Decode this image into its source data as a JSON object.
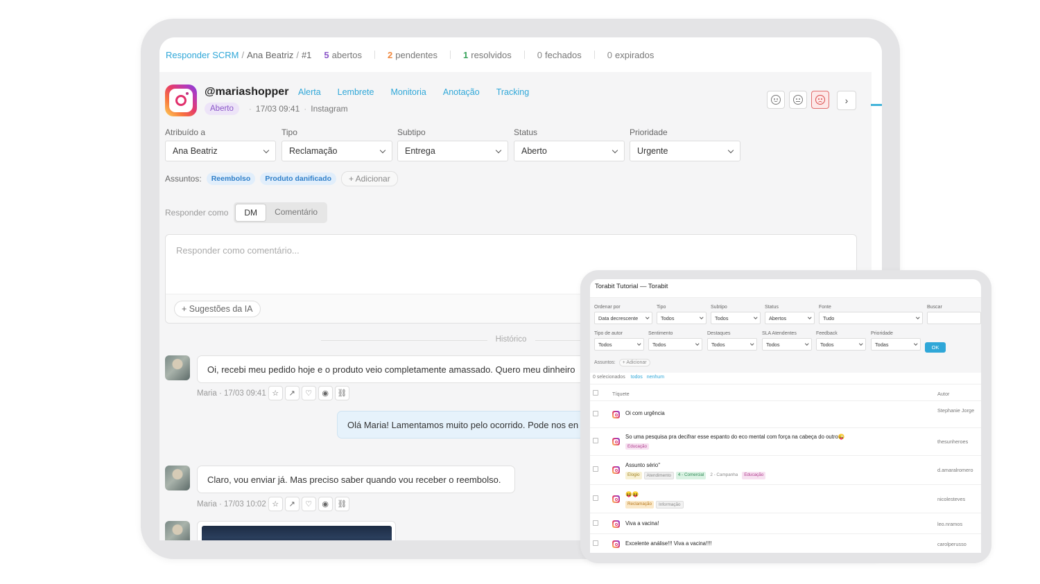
{
  "colors": {
    "accent": "#2fa7d8",
    "open": "#8a56c8",
    "pending": "#f0883e",
    "resolved": "#3aa35c",
    "negative": "#d94a4a"
  },
  "topbar": {
    "app": "Responder SCRM",
    "sep1": "/",
    "agent": "Ana Beatriz",
    "sep2": "/",
    "ticket": "#1",
    "stats": [
      {
        "num": "5",
        "label": "abertos",
        "color": "#8a56c8"
      },
      {
        "num": "2",
        "label": "pendentes",
        "color": "#f0883e"
      },
      {
        "num": "1",
        "label": "resolvidos",
        "color": "#3aa35c"
      },
      {
        "num": "0",
        "label": "fechados",
        "color": "#888888"
      },
      {
        "num": "0",
        "label": "expirados",
        "color": "#888888"
      }
    ]
  },
  "ticket": {
    "platform_icon": "instagram-icon",
    "handle": "@mariashopper",
    "actions": [
      "Alerta",
      "Lembrete",
      "Monitoria",
      "Anotação",
      "Tracking"
    ],
    "status_badge": "Aberto",
    "sep": "·",
    "datetime": "17/03 09:41",
    "source": "Instagram",
    "sentiment": [
      "positive",
      "neutral",
      "negative"
    ],
    "sentiment_selected": "negative",
    "next_icon": "›"
  },
  "fields": [
    {
      "label": "Atribuído a",
      "value": "Ana Beatriz"
    },
    {
      "label": "Tipo",
      "value": "Reclamação"
    },
    {
      "label": "Subtipo",
      "value": "Entrega"
    },
    {
      "label": "Status",
      "value": "Aberto"
    },
    {
      "label": "Prioridade",
      "value": "Urgente"
    }
  ],
  "subjects": {
    "label": "Assuntos:",
    "tags": [
      "Reembolso",
      "Produto danificado"
    ],
    "add": "+ Adicionar"
  },
  "reply": {
    "label": "Responder como",
    "options": [
      "DM",
      "Comentário"
    ],
    "selected": "DM",
    "placeholder": "Responder como comentário...",
    "ai_button": "+ Sugestões da IA"
  },
  "history_label": "Histórico",
  "messages": [
    {
      "text": "Oi, recebi meu pedido hoje e o produto veio completamente amassado. Quero meu dinheiro",
      "meta": "Maria · 17/03 09:41",
      "direction": "in"
    },
    {
      "text": "Olá Maria! Lamentamos muito pelo ocorrido. Pode nos en",
      "direction": "out"
    },
    {
      "text": "Claro, vou enviar já. Mas preciso saber quando vou receber o reembolso.",
      "meta": "Maria · 17/03 10:02",
      "direction": "in"
    }
  ],
  "message_tools": [
    "☆",
    "↗",
    "♡",
    "◉",
    "⛓"
  ],
  "small": {
    "title": "Torabit Tutorial — Torabit",
    "filters": [
      {
        "label": "Ordenar por",
        "value": "Data decrescente"
      },
      {
        "label": "Tipo",
        "value": "Todos"
      },
      {
        "label": "Subtipo",
        "value": "Todos"
      },
      {
        "label": "Status",
        "value": "Abertos"
      },
      {
        "label": "Fonte",
        "value": "Tudo"
      },
      {
        "label": "Buscar",
        "value": ""
      },
      {
        "label": "Tipo de autor",
        "value": "Todos"
      },
      {
        "label": "Sentimento",
        "value": "Todos"
      },
      {
        "label": "Destaques",
        "value": "Todos"
      },
      {
        "label": "SLA Atendentes",
        "value": "Todos"
      },
      {
        "label": "Feedback",
        "value": "Todos"
      },
      {
        "label": "Prioridade",
        "value": "Todas"
      }
    ],
    "ok": "OK",
    "subjects_label": "Assuntos:",
    "subjects_add": "+ Adicionar",
    "selected_count": "0 selecionados",
    "select_all": "todos",
    "select_none": "nenhum",
    "col_ticket": "Tíquete",
    "col_author": "Autor",
    "rows": [
      {
        "subject": "Oi com urgência",
        "tags": [],
        "author": "Stephanie Jorge"
      },
      {
        "subject": "So uma pesquisa pra decifrar esse espanto do eco mental com força na cabeça do outro😜",
        "tags": [
          "Educação"
        ],
        "author": "thesunheroes"
      },
      {
        "subject": "Assunto sério\"",
        "tags": [
          "Elogio",
          "Atendimento",
          "4 - Comercial",
          "2 - Campanha",
          "Educação"
        ],
        "author": "d.amaralromero"
      },
      {
        "subject": "😝😝",
        "tags": [
          "Reclamação",
          "Informação"
        ],
        "author": "nicolesteves"
      },
      {
        "subject": "Viva a vacina!",
        "tags": [],
        "author": "leo.nramos"
      },
      {
        "subject": "Excelente análise!!! Viva a vacina!!!!",
        "tags": [],
        "author": "carolperusso"
      }
    ]
  }
}
